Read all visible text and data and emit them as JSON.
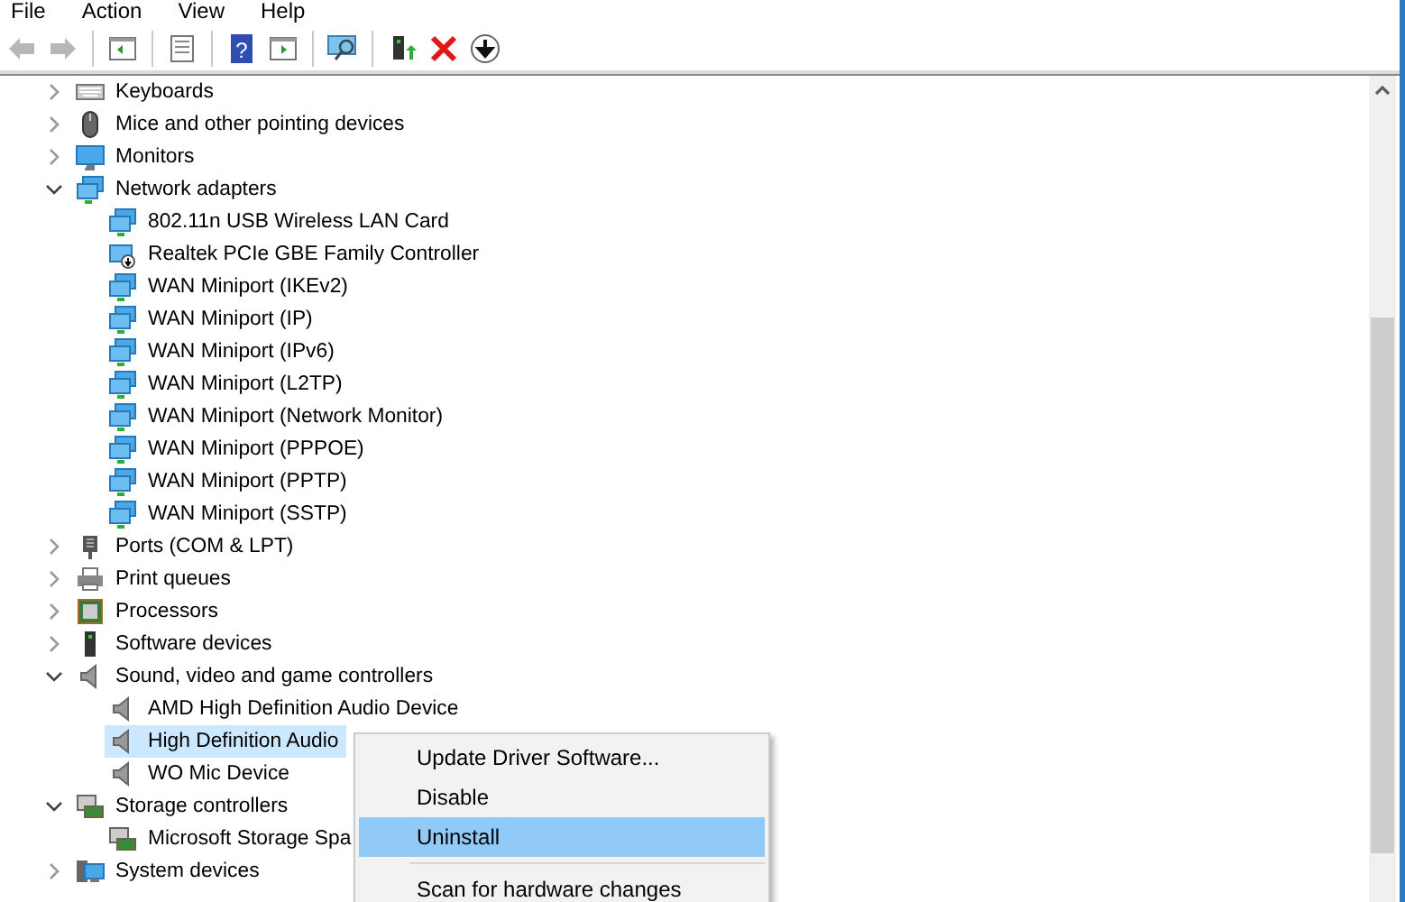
{
  "menu_bar": [
    "File",
    "Action",
    "View",
    "Help"
  ],
  "toolbar": [
    {
      "kind": "back",
      "disabled": true
    },
    {
      "kind": "forward",
      "disabled": true
    },
    {
      "kind": "sep"
    },
    {
      "kind": "tree"
    },
    {
      "kind": "sep"
    },
    {
      "kind": "properties"
    },
    {
      "kind": "sep"
    },
    {
      "kind": "help",
      "glyph": "?"
    },
    {
      "kind": "pane"
    },
    {
      "kind": "sep"
    },
    {
      "kind": "scan"
    },
    {
      "kind": "sep"
    },
    {
      "kind": "update"
    },
    {
      "kind": "uninstall"
    },
    {
      "kind": "disable"
    }
  ],
  "tree": [
    {
      "label": "Keyboards",
      "kind": "keyboard",
      "expanded": false
    },
    {
      "label": "Mice and other pointing devices",
      "kind": "mouse",
      "expanded": false
    },
    {
      "label": "Monitors",
      "kind": "monitor",
      "expanded": false
    },
    {
      "label": "Network adapters",
      "kind": "network",
      "expanded": true,
      "children": [
        {
          "label": "802.11n USB Wireless LAN Card",
          "kind": "network",
          "selected": false
        },
        {
          "label": "Realtek PCIe GBE Family Controller",
          "kind": "network-disabled",
          "selected": false
        },
        {
          "label": "WAN Miniport (IKEv2)",
          "kind": "network",
          "selected": false
        },
        {
          "label": "WAN Miniport (IP)",
          "kind": "network",
          "selected": false
        },
        {
          "label": "WAN Miniport (IPv6)",
          "kind": "network",
          "selected": false
        },
        {
          "label": "WAN Miniport (L2TP)",
          "kind": "network",
          "selected": false
        },
        {
          "label": "WAN Miniport (Network Monitor)",
          "kind": "network",
          "selected": false
        },
        {
          "label": "WAN Miniport (PPPOE)",
          "kind": "network",
          "selected": false
        },
        {
          "label": "WAN Miniport (PPTP)",
          "kind": "network",
          "selected": false
        },
        {
          "label": "WAN Miniport (SSTP)",
          "kind": "network",
          "selected": false
        }
      ]
    },
    {
      "label": "Ports (COM & LPT)",
      "kind": "port",
      "expanded": false
    },
    {
      "label": "Print queues",
      "kind": "printer",
      "expanded": false
    },
    {
      "label": "Processors",
      "kind": "processor",
      "expanded": false
    },
    {
      "label": "Software devices",
      "kind": "software",
      "expanded": false
    },
    {
      "label": "Sound, video and game controllers",
      "kind": "sound",
      "expanded": true,
      "children": [
        {
          "label": "AMD High Definition Audio Device",
          "kind": "sound",
          "selected": false
        },
        {
          "label": "High Definition Audio",
          "kind": "sound",
          "selected": true
        },
        {
          "label": "WO Mic Device",
          "kind": "sound",
          "selected": false
        }
      ]
    },
    {
      "label": "Storage controllers",
      "kind": "storage",
      "expanded": true,
      "children": [
        {
          "label": "Microsoft Storage Spa",
          "kind": "storage",
          "selected": false
        }
      ]
    },
    {
      "label": "System devices",
      "kind": "system",
      "expanded": false
    }
  ],
  "context_menu": [
    {
      "kind": "item",
      "label": "Update Driver Software...",
      "selected": false
    },
    {
      "kind": "item",
      "label": "Disable",
      "selected": false
    },
    {
      "kind": "item",
      "label": "Uninstall",
      "selected": true
    },
    {
      "kind": "separator"
    },
    {
      "kind": "item",
      "label": "Scan for hardware changes",
      "selected": false
    }
  ]
}
